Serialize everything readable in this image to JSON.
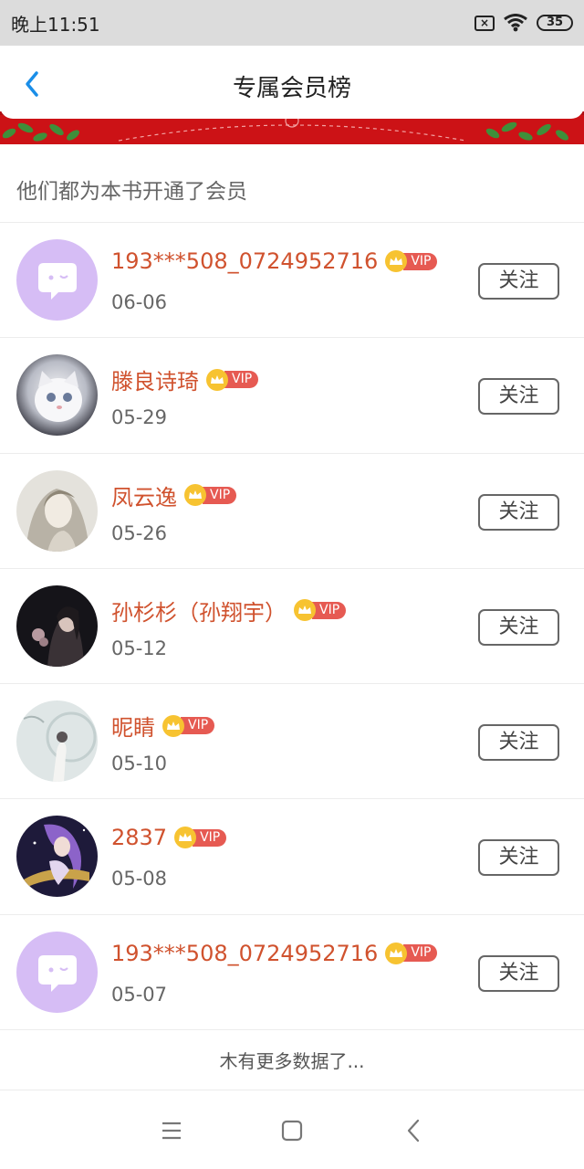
{
  "status_bar": {
    "time": "晚上11:51",
    "battery": "35"
  },
  "header": {
    "title": "专属会员榜"
  },
  "section": {
    "title": "他们都为本书开通了会员"
  },
  "members": [
    {
      "name": "193***508_0724952716",
      "date": "06-06",
      "badge": "VIP",
      "follow_label": "关注",
      "avatar": "default-chat-avatar"
    },
    {
      "name": "滕良诗琦",
      "date": "05-29",
      "badge": "VIP",
      "follow_label": "关注",
      "avatar": "white-kitten-photo"
    },
    {
      "name": "凤云逸",
      "date": "05-26",
      "badge": "VIP",
      "follow_label": "关注",
      "avatar": "illustrated-woman-portrait"
    },
    {
      "name": "孙杉杉（孙翔宇）",
      "date": "05-12",
      "badge": "VIP",
      "follow_label": "关注",
      "avatar": "dark-portrait-photo"
    },
    {
      "name": "昵睛",
      "date": "05-10",
      "badge": "VIP",
      "follow_label": "关注",
      "avatar": "pale-figure-photo"
    },
    {
      "name": "2837",
      "date": "05-08",
      "badge": "VIP",
      "follow_label": "关注",
      "avatar": "purple-anime-girl"
    },
    {
      "name": "193***508_0724952716",
      "date": "05-07",
      "badge": "VIP",
      "follow_label": "关注",
      "avatar": "default-chat-avatar"
    }
  ],
  "footer": {
    "no_more_text": "木有更多数据了..."
  },
  "colors": {
    "accent_blue": "#1a8ee8",
    "name_red": "#d0522e",
    "banner_red": "#cc1216",
    "vip_gold": "#f7c331",
    "vip_red": "#e65a52",
    "default_avatar_purple": "#d6bdf5"
  }
}
